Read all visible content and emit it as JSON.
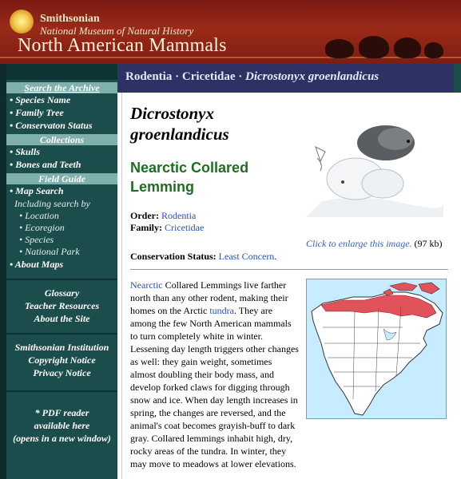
{
  "header": {
    "org": "Smithsonian",
    "museum": "National Museum of Natural History",
    "site_title": "North American Mammals"
  },
  "sidebar": {
    "archive_title": "Search the Archive",
    "archive_items": [
      "• Species Name",
      "• Family Tree",
      "• Conservaton Status"
    ],
    "collections_title": "Collections",
    "collections_items": [
      "• Skulls",
      "• Bones and Teeth"
    ],
    "field_guide_title": "Field Guide",
    "map_search": "• Map Search",
    "including": "Including search by",
    "search_by": [
      "• Location",
      "• Ecoregion",
      "• Species",
      "• National Park"
    ],
    "about_maps": "• About Maps",
    "resources": [
      "Glossary",
      "Teacher Resources",
      "About the Site"
    ],
    "institution": [
      "Smithsonian Institution",
      "Copyright Notice",
      "Privacy Notice"
    ],
    "pdf_note": [
      "* PDF reader",
      "available here",
      "(opens in a new window)"
    ]
  },
  "breadcrumb": {
    "order": "Rodentia",
    "sep1": " · ",
    "family": "Cricetidae",
    "sep2": " · ",
    "species": "Dicrostonyx groenlandicus"
  },
  "species": {
    "scientific_name_line1": "Dicrostonyx",
    "scientific_name_line2": "groenlandicus",
    "common_name_line1": "Nearctic Collared",
    "common_name_line2": "Lemming",
    "order_label": "Order:",
    "order_value": "Rodentia",
    "family_label": "Family:",
    "family_value": "Cricetidae",
    "conservation_label": "Conservation Status:",
    "conservation_value": "Least Concern",
    "period": "."
  },
  "image": {
    "caption_link": "Click to enlarge this image.",
    "caption_size": " (97 kb)"
  },
  "description": {
    "link1": "Nearctic",
    "text1": " Collared Lemmings live farther north than any other rodent, making their homes on the Arctic ",
    "link2": "tundra",
    "text2": ". They are among the few North American mammals to turn completely white in winter. Lessening day length triggers other changes as well: they gain weight, sometimes almost doubling their body mass, and develop forked claws for digging through snow and ice. When day length increases in spring, the changes are reversed, and the animal's coat becomes grayish-buff to dark gray. Collared lemmings inhabit high, dry, rocky areas of the tundra. In winter, they may move to meadows at lower elevations."
  },
  "colors": {
    "header_red": "#8a2215",
    "sidebar_teal": "#1a4d4b",
    "breadcrumb_navy": "#2c3264",
    "common_name_green": "#1f6e1f",
    "link_blue": "#2a4fb4",
    "range_red": "#e0535a"
  }
}
